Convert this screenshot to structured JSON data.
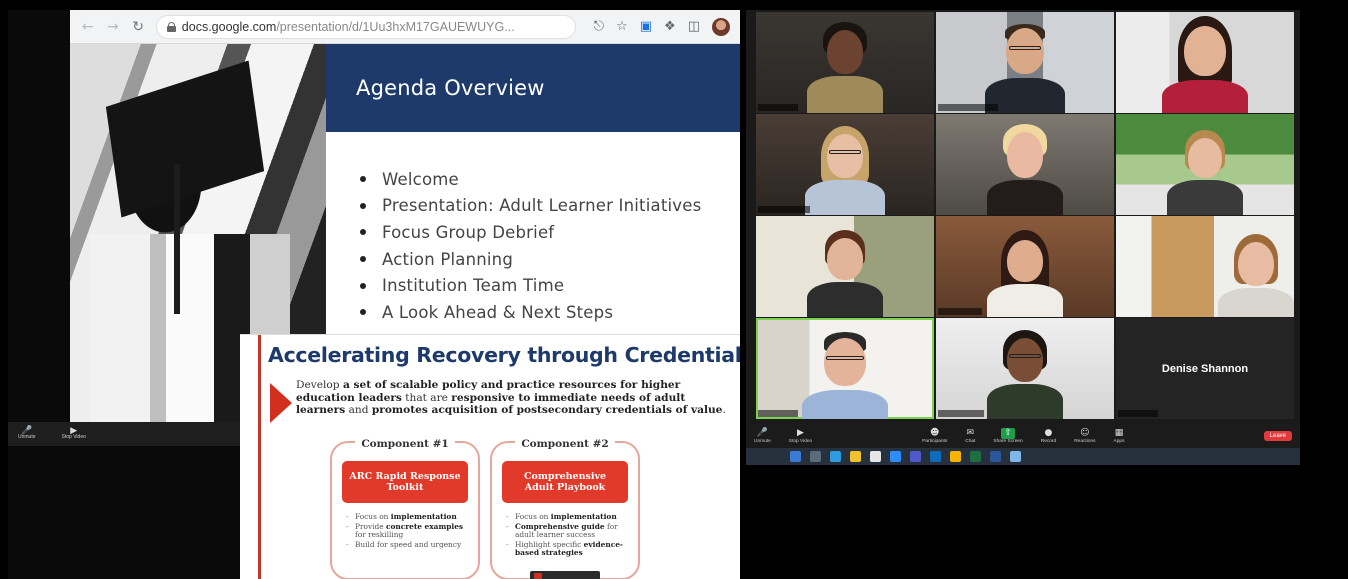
{
  "browser": {
    "url_host": "docs.google.com",
    "url_path": "/presentation/d/1Uu3hxM17GAUEWUYG...",
    "icons": [
      "back-arrow-icon",
      "forward-arrow-icon",
      "reload-icon",
      "lock-icon",
      "share-icon",
      "star-icon",
      "zoom-extension-icon",
      "puzzle-icon",
      "sidebar-icon",
      "profile-avatar"
    ]
  },
  "left_self_view": {
    "controls": [
      {
        "icon": "microphone-icon",
        "label": "Unmute"
      },
      {
        "icon": "camera-icon",
        "label": "Stop Video"
      }
    ]
  },
  "agenda_slide": {
    "title": "Agenda Overview",
    "items": [
      "Welcome",
      "Presentation: Adult Learner Initiatives",
      "Focus Group Debrief",
      "Action Planning",
      "Institution Team Time",
      "A Look Ahead & Next Steps"
    ],
    "accent_color": "#1e3a6b"
  },
  "arc_slide": {
    "title": "Accelerating Recovery through Credentials",
    "desc_1": "Develop ",
    "desc_2": "a set of scalable policy and practice resources for higher education leaders",
    "desc_3": " that are ",
    "desc_4": "responsive to immediate needs of adult learners",
    "desc_5": " and ",
    "desc_6": "promotes acquisition of postsecondary credentials of value",
    "desc_7": ".",
    "components": [
      {
        "label": "Component #1",
        "name": "ARC Rapid Response Toolkit",
        "p1a": "Focus on ",
        "p1b": "implementation",
        "p2a": "Provide ",
        "p2b": "concrete examples",
        "p2c": " for reskilling",
        "p3": "Build for speed and urgency"
      },
      {
        "label": "Component #2",
        "name": "Comprehensive Adult Playbook",
        "p1a": "Focus on ",
        "p1b": "implementation",
        "p2a": "",
        "p2b": "Comprehensive guide",
        "p2c": " for adult learner success",
        "p3a": "Highlight specific ",
        "p3b": "evidence-based strategies"
      }
    ],
    "accent_color": "#e23a2a"
  },
  "call": {
    "name_only_participant": "Denise Shannon",
    "toolbar": [
      {
        "icon": "microphone-icon",
        "label": "Unmute"
      },
      {
        "icon": "camera-icon",
        "label": "Stop Video"
      },
      {
        "icon": "participants-icon",
        "label": "Participants"
      },
      {
        "icon": "chat-icon",
        "label": "Chat"
      },
      {
        "icon": "share-screen-icon",
        "label": "Share Screen"
      },
      {
        "icon": "record-icon",
        "label": "Record"
      },
      {
        "icon": "reactions-icon",
        "label": "Reactions"
      },
      {
        "icon": "apps-icon",
        "label": "Apps"
      }
    ],
    "end_label": "Leave",
    "speaking_color": "#7bd24e"
  }
}
